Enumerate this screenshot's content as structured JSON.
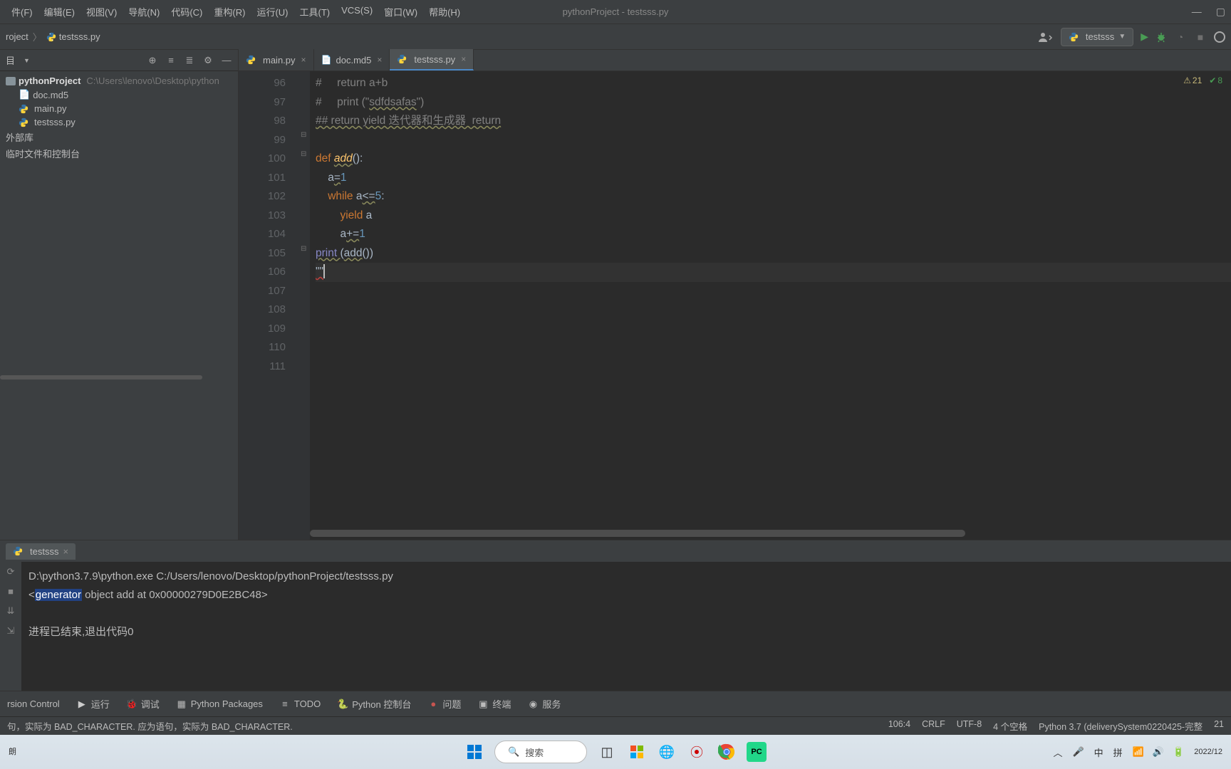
{
  "menu": {
    "file": "件(F)",
    "edit": "编辑(E)",
    "view": "视图(V)",
    "nav": "导航(N)",
    "code": "代码(C)",
    "refactor": "重构(R)",
    "run": "运行(U)",
    "tools": "工具(T)",
    "vcs": "VCS(S)",
    "window": "窗口(W)",
    "help": "帮助(H)"
  },
  "window_title": "pythonProject - testsss.py",
  "breadcrumb": {
    "root": "roject",
    "file": "testsss.py"
  },
  "run_config": {
    "name": "testsss"
  },
  "project_header": "目",
  "tree": {
    "project": "pythonProject",
    "project_path": "C:\\Users\\lenovo\\Desktop\\python",
    "files": [
      "doc.md5",
      "main.py",
      "testsss.py"
    ],
    "ext_lib": "外部库",
    "scratch": "临时文件和控制台"
  },
  "tabs": [
    {
      "name": "main.py",
      "active": false
    },
    {
      "name": "doc.md5",
      "active": false
    },
    {
      "name": "testsss.py",
      "active": true
    }
  ],
  "inspection": {
    "warnings": "21",
    "oks": "8"
  },
  "code_lines": [
    {
      "n": "96",
      "html": "<span class='comment'>#     return a+b</span>"
    },
    {
      "n": "97",
      "html": "<span class='comment'>#     print (\"<span class='warn'>sdfdsafas</span>\")</span>"
    },
    {
      "n": "98",
      "html": "<span class='comment warn'>## return yield 迭代器和生成器  return</span>"
    },
    {
      "n": "99",
      "html": ""
    },
    {
      "n": "100",
      "html": "<span class='keyword'>def </span><span class='fn warn'>add</span>():"
    },
    {
      "n": "101",
      "html": "    a<span class='warn'>=</span><span class='num'>1</span>"
    },
    {
      "n": "102",
      "html": "    <span class='keyword'>while </span>a<span class='warn'>&lt;=</span><span class='num'>5</span>:"
    },
    {
      "n": "103",
      "html": "        <span class='keyword'>yield </span>a"
    },
    {
      "n": "104",
      "html": "        a<span class='warn'>+=</span><span class='num'>1</span>"
    },
    {
      "n": "105",
      "html": "<span class='builtin warn'>print </span>(<span class='warn'>add</span>())"
    },
    {
      "n": "106",
      "html": "<span class='err'>\"\"</span><span class='caret'></span>",
      "caret": true
    },
    {
      "n": "107",
      "html": ""
    },
    {
      "n": "108",
      "html": ""
    },
    {
      "n": "109",
      "html": ""
    },
    {
      "n": "110",
      "html": ""
    },
    {
      "n": "111",
      "html": ""
    }
  ],
  "run_panel": {
    "tab": "testsss",
    "line1": "D:\\python3.7.9\\python.exe C:/Users/lenovo/Desktop/pythonProject/testsss.py",
    "line2_pre": "<",
    "line2_sel": "generator",
    "line2_post": " object add at 0x00000279D0E2BC48>",
    "line3": "进程已结束,退出代码0"
  },
  "toolwindows": {
    "vcs": "rsion Control",
    "run": "运行",
    "debug": "调试",
    "packages": "Python Packages",
    "todo": "TODO",
    "pyconsole": "Python 控制台",
    "problems": "问题",
    "terminal": "终端",
    "services": "服务"
  },
  "status": {
    "left": "句，实际为 BAD_CHARACTER. 应为语句，实际为 BAD_CHARACTER.",
    "pos": "106:4",
    "eol": "CRLF",
    "enc": "UTF-8",
    "indent": "4 个空格",
    "interp": "Python 3.7 (deliverySystem0220425-完整",
    "right_edge": "21"
  },
  "taskbar": {
    "left1": "",
    "left2": "朗",
    "search": "搜索",
    "ime1": "中",
    "ime2": "拼",
    "date": "2022/12"
  }
}
